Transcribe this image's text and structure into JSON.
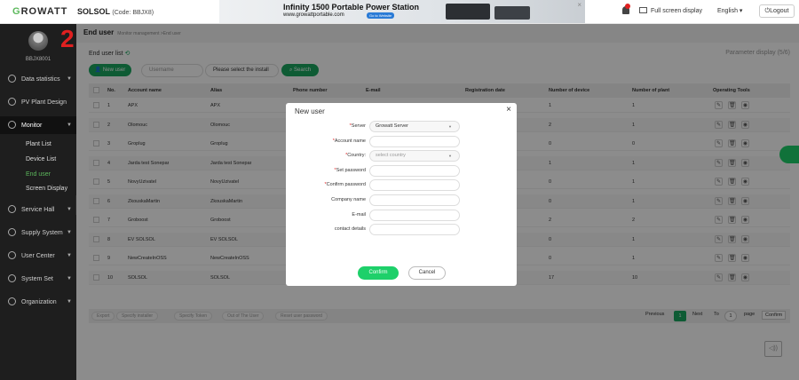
{
  "header": {
    "logo_g": "G",
    "logo_rest": "ROWATT",
    "plant_name": "SOLSOL",
    "plant_code": "(Code: BBJX8)",
    "ad_title": "Infinity 1500 Portable Power Station",
    "ad_url": "www.growattportable.com",
    "ad_button": "Go to Website",
    "ad_close": "×",
    "fullscreen": "Full screen display",
    "language": "English ▾",
    "logout": "Logout"
  },
  "sidebar": {
    "username": "BBJX8001",
    "step_number": "2",
    "items": [
      {
        "label": "Data statistics",
        "icon": "chart-icon"
      },
      {
        "label": "PV Plant Design",
        "icon": "plant-design-icon"
      },
      {
        "label": "Monitor",
        "icon": "monitor-icon"
      },
      {
        "label": "Service Hall",
        "icon": "service-icon"
      },
      {
        "label": "Supply System",
        "icon": "supply-icon"
      },
      {
        "label": "User Center",
        "icon": "user-icon"
      },
      {
        "label": "System Set",
        "icon": "settings-icon"
      },
      {
        "label": "Organization",
        "icon": "organization-icon"
      }
    ],
    "monitor_sub": [
      "Plant List",
      "Device List",
      "End user",
      "Screen Display"
    ],
    "toggle_glyph": "≡"
  },
  "breadcrumb": {
    "title": "End user",
    "path": "Monitor management >End user"
  },
  "toolbar": {
    "list_title": "End user list",
    "param_display": "Parameter display (5/6)",
    "new_user": "New user",
    "username_placeholder": "Username",
    "install_select": "Please select the install",
    "search": "Search"
  },
  "table": {
    "headers": [
      "No.",
      "Account name",
      "Alias",
      "Phone number",
      "E-mail",
      "Registration date",
      "Number of device",
      "Number of plant",
      "Operating Tools"
    ],
    "rows": [
      {
        "no": "1",
        "account": "APX",
        "alias": "APX",
        "devices": "1",
        "plants": "1"
      },
      {
        "no": "2",
        "account": "Olomouc",
        "alias": "Olomouc",
        "devices": "2",
        "plants": "1"
      },
      {
        "no": "3",
        "account": "Groplug",
        "alias": "Groplug",
        "devices": "0",
        "plants": "0"
      },
      {
        "no": "4",
        "account": "Jarda test Sonepar",
        "alias": "Jarda test Sonepar",
        "devices": "1",
        "plants": "1"
      },
      {
        "no": "5",
        "account": "NovyUzivatel",
        "alias": "NovyUzivatel",
        "devices": "0",
        "plants": "1"
      },
      {
        "no": "6",
        "account": "ZkouskaMartin",
        "alias": "ZkouskaMartin",
        "devices": "0",
        "plants": "1"
      },
      {
        "no": "7",
        "account": "Groboost",
        "alias": "Groboost",
        "devices": "2",
        "plants": "2"
      },
      {
        "no": "8",
        "account": "EV SOLSOL",
        "alias": "EV SOLSOL",
        "devices": "0",
        "plants": "1"
      },
      {
        "no": "9",
        "account": "NewCreateInOSS",
        "alias": "NewCreateInOSS",
        "devices": "0",
        "plants": "1"
      },
      {
        "no": "10",
        "account": "SOLSOL",
        "alias": "SOLSOL",
        "devices": "17",
        "plants": "10"
      }
    ]
  },
  "footer": {
    "buttons": [
      "Export",
      "Specify installer",
      "Specify Token",
      "Out of The User",
      "Reset user password"
    ],
    "previous": "Previous",
    "current_page": "1",
    "next": "Next",
    "to": "To",
    "page_input": "1",
    "page": "page",
    "confirm": "Confirm"
  },
  "modal": {
    "title": "New user",
    "close": "×",
    "fields": [
      {
        "label": "Server",
        "required": true,
        "value": "Growatt Server",
        "type": "select"
      },
      {
        "label": "Account name",
        "required": true,
        "value": ""
      },
      {
        "label": "Country:",
        "required": true,
        "value": "select country",
        "type": "select"
      },
      {
        "label": "Set password",
        "required": true,
        "value": ""
      },
      {
        "label": "Confirm password",
        "required": true,
        "value": ""
      },
      {
        "label": "Company name",
        "required": false,
        "value": ""
      },
      {
        "label": "E-mail",
        "required": false,
        "value": ""
      },
      {
        "label": "contact details",
        "required": false,
        "value": ""
      }
    ],
    "confirm": "Confirm",
    "cancel": "Cancel",
    "req_mark": "*"
  },
  "colors": {
    "accent": "#1aa760",
    "sidebar": "#1e1e1e",
    "danger": "#e02020"
  }
}
